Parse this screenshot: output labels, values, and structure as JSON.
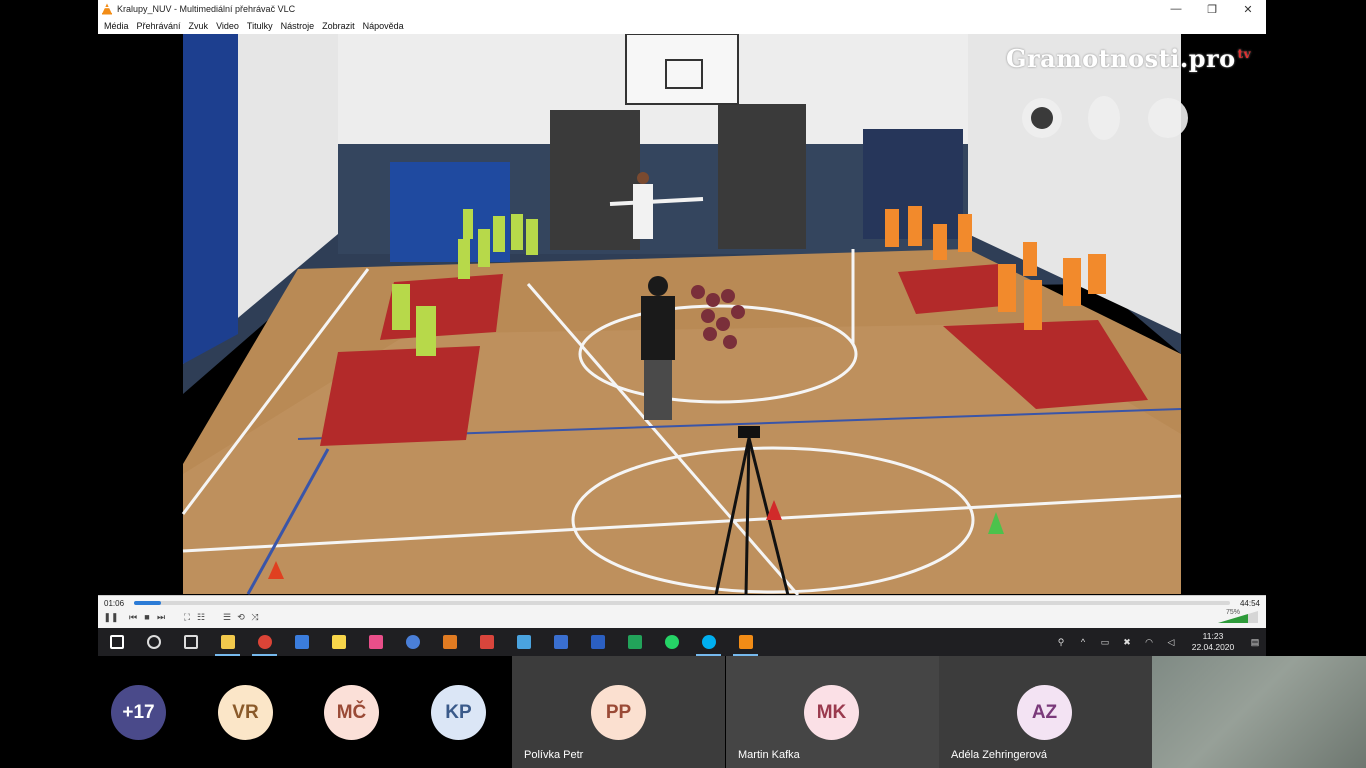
{
  "window": {
    "title": "Kralupy_NUV - Multimediální přehrávač VLC",
    "minimize": "—",
    "restore": "❐",
    "close": "✕"
  },
  "menu": [
    "Média",
    "Přehrávání",
    "Zvuk",
    "Video",
    "Titulky",
    "Nástroje",
    "Zobrazit",
    "Nápověda"
  ],
  "video": {
    "logo_text": "Gramotnosti.pro",
    "logo_suffix": "tv"
  },
  "controls": {
    "elapsed": "01:06",
    "total": "44:54",
    "progress": 0.025,
    "volume_label": "75%",
    "volume": 0.75
  },
  "taskbar": {
    "apps": [
      {
        "name": "start-icon",
        "color": "#ffffff"
      },
      {
        "name": "search-icon",
        "color": "#dddddd"
      },
      {
        "name": "task-view-icon",
        "color": "#dddddd"
      },
      {
        "name": "file-explorer-icon",
        "color": "#f2c94c"
      },
      {
        "name": "chrome-icon",
        "color": "#db4437"
      },
      {
        "name": "calendar-icon",
        "color": "#3b7ddd"
      },
      {
        "name": "sticky-notes-icon",
        "color": "#f7d54a"
      },
      {
        "name": "photos-icon",
        "color": "#e94f8a"
      },
      {
        "name": "contacts-icon",
        "color": "#4a7fd8"
      },
      {
        "name": "euro-app-icon",
        "color": "#e07b22"
      },
      {
        "name": "mail-icon",
        "color": "#d9453c"
      },
      {
        "name": "camera-app-icon",
        "color": "#4aa3df"
      },
      {
        "name": "document-app-icon",
        "color": "#3a6fd0"
      },
      {
        "name": "word-icon",
        "color": "#2b5fc1"
      },
      {
        "name": "sheets-icon",
        "color": "#22a35a"
      },
      {
        "name": "whatsapp-icon",
        "color": "#25d366"
      },
      {
        "name": "skype-icon",
        "color": "#00aff0"
      },
      {
        "name": "vlc-icon",
        "color": "#f28c16"
      }
    ],
    "clock_time": "11:23",
    "clock_date": "22.04.2020"
  },
  "participants": {
    "more_count": "+17",
    "avatars": [
      {
        "initials": "VR",
        "bg": "#fbe6c8",
        "fg": "#8a5a2a"
      },
      {
        "initials": "MČ",
        "bg": "#fbe0d8",
        "fg": "#9a4a36"
      },
      {
        "initials": "KP",
        "bg": "#dbe6f6",
        "fg": "#3a5a8a"
      }
    ],
    "tiles": [
      {
        "initials": "PP",
        "name": "Polívka Petr",
        "bg": "#fbe0d0",
        "fg": "#9a4a36"
      },
      {
        "initials": "MK",
        "name": "Martin Kafka",
        "bg": "#fbe0e6",
        "fg": "#9a3a4e"
      },
      {
        "initials": "AZ",
        "name": "Adéla Zehringerová",
        "bg": "#f3e3f3",
        "fg": "#7a3a7a"
      }
    ]
  }
}
